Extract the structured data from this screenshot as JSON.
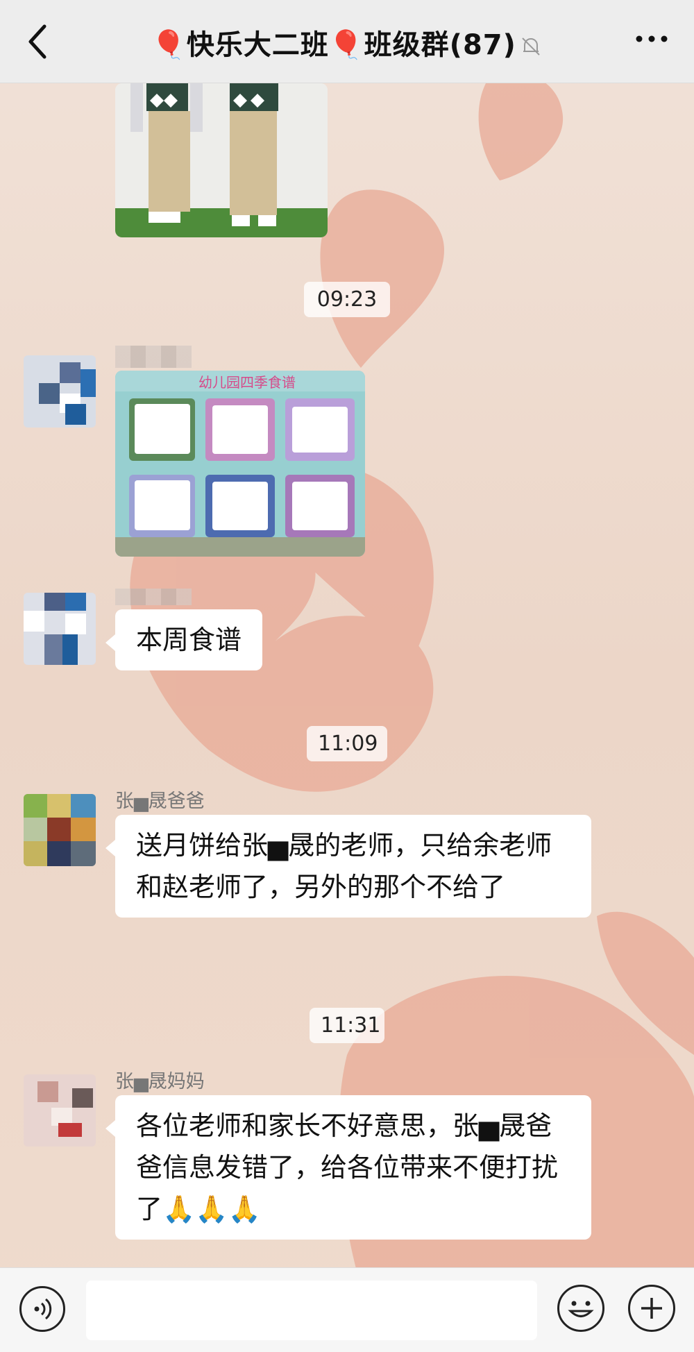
{
  "header": {
    "back_icon": "chevron-left-icon",
    "title": "🎈快乐大二班🎈班级群(87)",
    "mute_icon": "bell-muted-icon",
    "more_icon": "more-dots-icon"
  },
  "messages": {
    "timestamp_1": "09:23",
    "timestamp_2": "11:09",
    "timestamp_3": "11:31",
    "msg_menu_caption": "幼儿园四季食谱",
    "msg_text_1": "本周食谱",
    "sender_3": "张▅晟爸爸",
    "msg_text_3": "送月饼给张▅晟的老师，只给余老师和赵老师了，另外的那个不给了",
    "sender_4": "张▅晟妈妈",
    "msg_text_4": "各位老师和家长不好意思，张▅晟爸爸信息发错了，给各位带来不便打扰了🙏🙏🙏"
  },
  "input_bar": {
    "voice_icon": "voice-icon",
    "emoji_icon": "emoji-icon",
    "plus_icon": "plus-icon",
    "placeholder": ""
  },
  "colors": {
    "header_bg": "#ededed",
    "bubble_bg": "#ffffff",
    "wallpaper_heart": "#e7a58f"
  }
}
